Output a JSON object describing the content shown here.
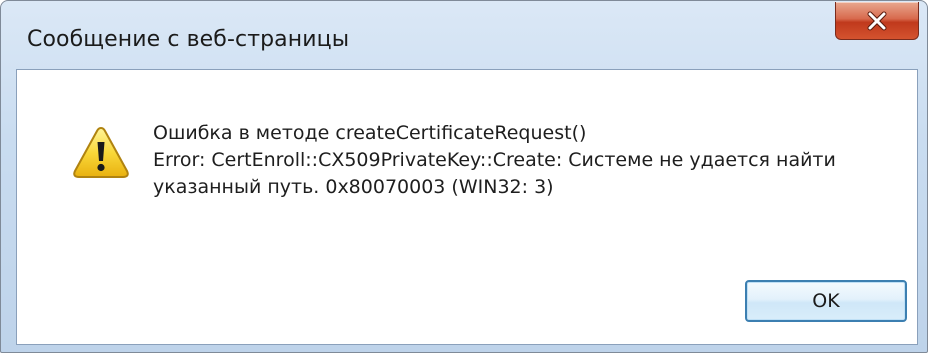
{
  "window": {
    "title": "Сообщение с веб-страницы",
    "close_icon": "close-x-icon"
  },
  "content": {
    "icon": "warning-icon",
    "message_lines": [
      "Ошибка в методе createCertificateRequest()",
      "Error: CertEnroll::CX509PrivateKey::Create: Системе не удается найти",
      "указанный путь. 0x80070003 (WIN32: 3)"
    ]
  },
  "buttons": {
    "ok_label": "OK"
  },
  "colors": {
    "close_button": "#c9452a",
    "warning_yellow": "#f7d02e",
    "ok_border": "#3c7fb1"
  }
}
